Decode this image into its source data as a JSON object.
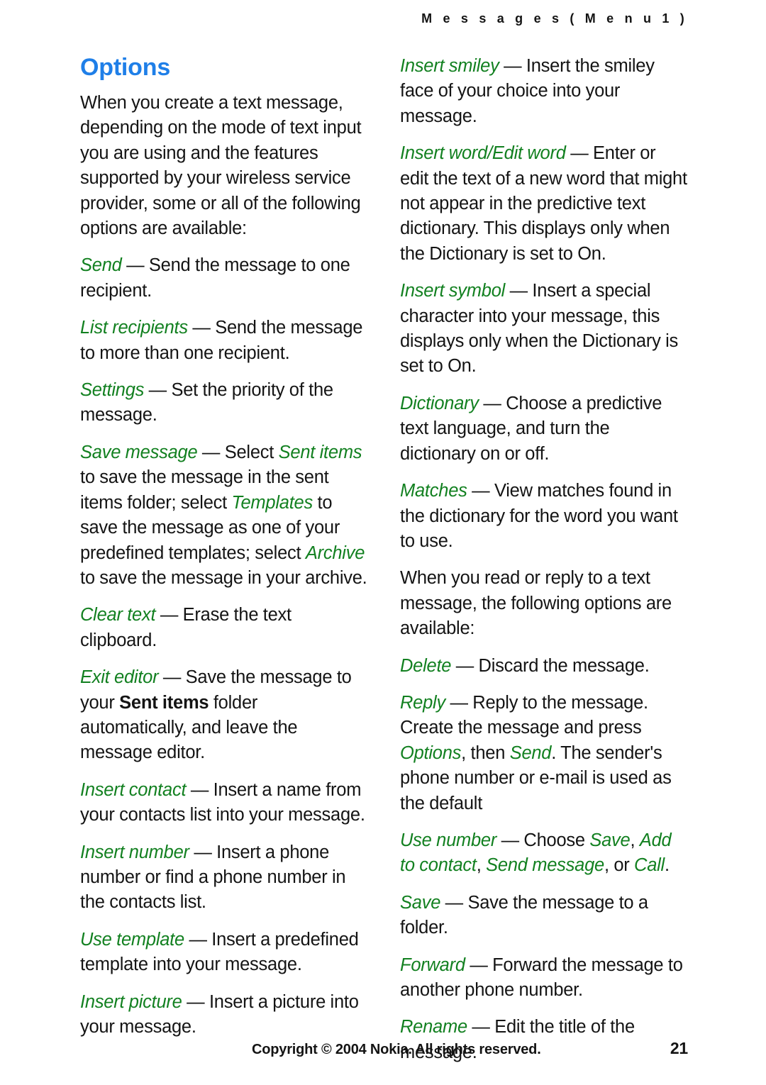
{
  "header": {
    "running_title": "M e s s a g e s   ( M e n u   1 )"
  },
  "title": "Options",
  "left_column": {
    "intro": "When you create a text message, depending on the mode of text input you are using and the features supported by your wireless service provider, some or all of the following options are available:",
    "entries": [
      {
        "term": "Send",
        "dash": " — ",
        "description": "Send the message to one recipient."
      },
      {
        "term": "List recipients",
        "dash": " — ",
        "description": "Send the message to more than one recipient."
      },
      {
        "term": "Settings",
        "dash": " — ",
        "description": "Set the priority of the message."
      },
      {
        "term": "Save message",
        "dash": " — ",
        "desc_part1": "Select ",
        "inline1": "Sent items",
        "desc_part2": " to save the message in the sent items folder; select ",
        "inline2": "Templates",
        "desc_part3": " to save the message as one of your predefined templates; select ",
        "inline3": "Archive",
        "desc_part4": " to save the message in your archive."
      },
      {
        "term": "Clear text",
        "dash": " — ",
        "description": "Erase the text clipboard."
      },
      {
        "term": "Exit editor",
        "dash": " — ",
        "desc_part1": "Save the message to your ",
        "bold1": "Sent items",
        "desc_part2": " folder automatically, and leave the message editor."
      },
      {
        "term": "Insert contact",
        "dash": " — ",
        "description": "Insert a name from your contacts list into your message."
      },
      {
        "term": "Insert number",
        "dash": " — ",
        "description": "Insert a phone number or find a phone number in the contacts list."
      },
      {
        "term": "Use template",
        "dash": " — ",
        "description": "Insert a predefined template into your message."
      },
      {
        "term": "Insert picture",
        "dash": " — ",
        "description": "Insert a picture into your message."
      }
    ]
  },
  "right_column": {
    "entries": [
      {
        "term": "Insert smiley",
        "dash": " — ",
        "description": "Insert the smiley face of your choice into your message."
      },
      {
        "term": "Insert word/Edit word",
        "dash": " — ",
        "description": "Enter or edit the text of a new word that might not appear in the predictive text dictionary. This displays only when the Dictionary is set to On."
      },
      {
        "term": "Insert symbol",
        "dash": " — ",
        "description": "Insert a special character into your message, this displays only when the Dictionary is set to On."
      },
      {
        "term": "Dictionary",
        "dash": " — ",
        "description": "Choose a predictive text language, and turn the dictionary on or off."
      },
      {
        "term": "Matches",
        "dash": " — ",
        "description": "View matches found in the dictionary for the word you want to use."
      }
    ],
    "read_reply_intro": "When you read or reply to a text message, the following options are available:",
    "read_entries": [
      {
        "term": "Delete",
        "dash": " — ",
        "description": "Discard the message."
      },
      {
        "term": "Reply",
        "dash": " — ",
        "desc_part1": "Reply to the message. Create the message and press ",
        "inline1": "Options",
        "desc_part2": ", then ",
        "inline2": "Send",
        "desc_part3": ". The sender's phone number or e-mail is used as the default"
      },
      {
        "term": "Use number",
        "dash": " — ",
        "desc_part1": "Choose ",
        "inline1": "Save",
        "desc_part2": ", ",
        "inline2": "Add to contact",
        "desc_part3": ", ",
        "inline3": "Send message",
        "desc_part4": ", or ",
        "inline4": "Call",
        "desc_part5": "."
      },
      {
        "term": "Save",
        "dash": " — ",
        "description": "Save the message to a folder."
      },
      {
        "term": "Forward",
        "dash": " — ",
        "description": "Forward the message to another phone number."
      },
      {
        "term": "Rename",
        "dash": " — ",
        "description": "Edit the title of the message."
      }
    ]
  },
  "footer": {
    "copyright": "Copyright © 2004 Nokia. All rights reserved.",
    "page_number": "21"
  },
  "colors": {
    "heading_blue": "#1f7fe8",
    "term_green": "#128020",
    "body_text": "#141414"
  }
}
